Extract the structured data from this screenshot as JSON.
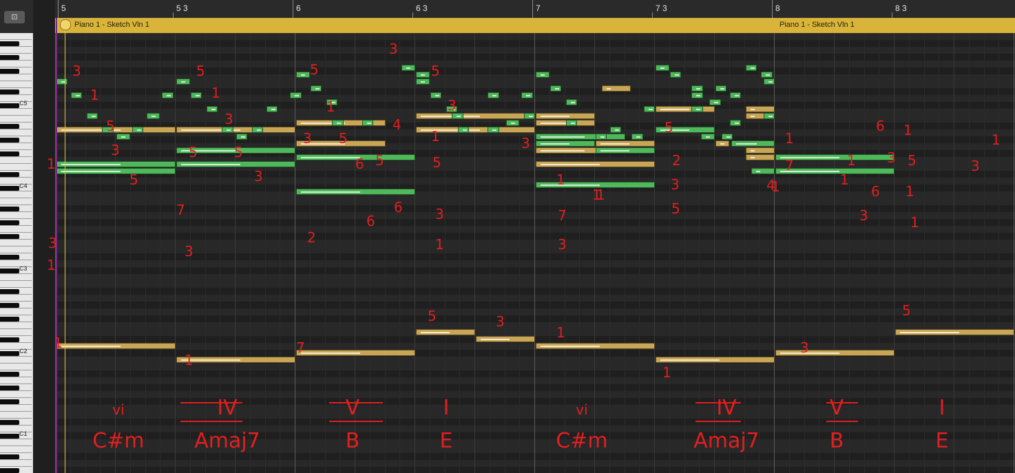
{
  "toolbar": {
    "catch_icon": "catch-playhead-icon",
    "catch_label": "⊡"
  },
  "ruler": {
    "bar_labels": [
      "5",
      "5 3",
      "6",
      "6 3",
      "7",
      "7 3",
      "8",
      "8 3"
    ]
  },
  "region": {
    "names": [
      "Piano 1 - Sketch Vln 1",
      "Piano 1 - Sketch Vln 1"
    ]
  },
  "keyboard": {
    "octave_labels": [
      "C5",
      "C4",
      "C3",
      "C2",
      "C1"
    ]
  },
  "colors": {
    "note_green": "#4fb85a",
    "note_gold": "#c9a655",
    "region": "#d8b43a",
    "annotation": "#e21f1f"
  },
  "notes": [
    {
      "row": 3,
      "start": 5.0,
      "len": 0.1,
      "c": "g"
    },
    {
      "row": 5,
      "start": 5.12,
      "len": 0.1,
      "c": "g"
    },
    {
      "row": 8,
      "start": 5.25,
      "len": 0.1,
      "c": "g"
    },
    {
      "row": 10,
      "start": 5.0,
      "len": 1.0,
      "c": "y"
    },
    {
      "row": 10,
      "start": 5.38,
      "len": 0.1,
      "c": "g"
    },
    {
      "row": 10,
      "start": 5.63,
      "len": 0.1,
      "c": "g"
    },
    {
      "row": 11,
      "start": 5.5,
      "len": 0.12,
      "c": "g"
    },
    {
      "row": 8,
      "start": 5.75,
      "len": 0.12,
      "c": "g"
    },
    {
      "row": 5,
      "start": 5.88,
      "len": 0.1,
      "c": "g"
    },
    {
      "row": 3,
      "start": 6.0,
      "len": 0.12,
      "c": "g"
    },
    {
      "row": 5,
      "start": 6.12,
      "len": 0.1,
      "c": "g"
    },
    {
      "row": 7,
      "start": 6.25,
      "len": 0.1,
      "c": "g"
    },
    {
      "row": 10,
      "start": 6.0,
      "len": 1.0,
      "c": "y"
    },
    {
      "row": 10,
      "start": 6.38,
      "len": 0.1,
      "c": "g"
    },
    {
      "row": 10,
      "start": 6.63,
      "len": 0.1,
      "c": "g"
    },
    {
      "row": 11,
      "start": 6.5,
      "len": 0.1,
      "c": "g"
    },
    {
      "row": 7,
      "start": 6.75,
      "len": 0.1,
      "c": "g"
    },
    {
      "row": 5,
      "start": 6.95,
      "len": 0.1,
      "c": "g"
    },
    {
      "row": 15,
      "start": 5.0,
      "len": 1.0,
      "c": "g"
    },
    {
      "row": 16,
      "start": 5.0,
      "len": 1.0,
      "c": "g"
    },
    {
      "row": 13,
      "start": 6.0,
      "len": 1.0,
      "c": "g"
    },
    {
      "row": 15,
      "start": 6.0,
      "len": 1.0,
      "c": "g"
    },
    {
      "row": 2,
      "start": 7.0,
      "len": 0.12,
      "c": "g"
    },
    {
      "row": 4,
      "start": 7.12,
      "len": 0.1,
      "c": "g"
    },
    {
      "row": 6,
      "start": 7.25,
      "len": 0.1,
      "c": "g"
    },
    {
      "row": 9,
      "start": 7.0,
      "len": 0.75,
      "c": "y"
    },
    {
      "row": 9,
      "start": 7.3,
      "len": 0.1,
      "c": "g"
    },
    {
      "row": 9,
      "start": 7.55,
      "len": 0.1,
      "c": "g"
    },
    {
      "row": 12,
      "start": 7.0,
      "len": 0.75,
      "c": "y"
    },
    {
      "row": 14,
      "start": 7.0,
      "len": 1.0,
      "c": "g"
    },
    {
      "row": 1,
      "start": 7.88,
      "len": 0.12,
      "c": "g"
    },
    {
      "row": 2,
      "start": 8.0,
      "len": 0.12,
      "c": "g"
    },
    {
      "row": 19,
      "start": 7.0,
      "len": 1.0,
      "c": "g"
    },
    {
      "row": 3,
      "start": 8.0,
      "len": 0.12,
      "c": "g"
    },
    {
      "row": 5,
      "start": 8.12,
      "len": 0.1,
      "c": "g"
    },
    {
      "row": 7,
      "start": 8.25,
      "len": 0.1,
      "c": "g"
    },
    {
      "row": 8,
      "start": 8.0,
      "len": 1.0,
      "c": "y"
    },
    {
      "row": 8,
      "start": 8.3,
      "len": 0.1,
      "c": "g"
    },
    {
      "row": 10,
      "start": 8.0,
      "len": 1.0,
      "c": "y"
    },
    {
      "row": 10,
      "start": 8.35,
      "len": 0.1,
      "c": "g"
    },
    {
      "row": 10,
      "start": 8.6,
      "len": 0.1,
      "c": "g"
    },
    {
      "row": 5,
      "start": 8.6,
      "len": 0.1,
      "c": "g"
    },
    {
      "row": 9,
      "start": 8.75,
      "len": 0.12,
      "c": "g"
    },
    {
      "row": 8,
      "start": 8.9,
      "len": 0.1,
      "c": "g"
    },
    {
      "row": 5,
      "start": 8.88,
      "len": 0.1,
      "c": "g"
    },
    {
      "row": 13,
      "start": 9.0,
      "len": 0.75,
      "c": "y"
    },
    {
      "row": 11,
      "start": 9.0,
      "len": 0.75,
      "c": "g"
    },
    {
      "row": 15,
      "start": 9.0,
      "len": 1.0,
      "c": "y"
    },
    {
      "row": 18,
      "start": 9.0,
      "len": 1.0,
      "c": "g"
    },
    {
      "row": 2,
      "start": 9.0,
      "len": 0.12,
      "c": "g"
    },
    {
      "row": 4,
      "start": 9.12,
      "len": 0.1,
      "c": "g"
    },
    {
      "row": 6,
      "start": 9.25,
      "len": 0.1,
      "c": "g"
    },
    {
      "row": 9,
      "start": 9.0,
      "len": 0.5,
      "c": "y"
    },
    {
      "row": 9,
      "start": 9.25,
      "len": 0.1,
      "c": "g"
    },
    {
      "row": 12,
      "start": 9.0,
      "len": 0.5,
      "c": "g"
    },
    {
      "row": 11,
      "start": 9.5,
      "len": 0.1,
      "c": "g"
    },
    {
      "row": 10,
      "start": 9.62,
      "len": 0.1,
      "c": "g"
    },
    {
      "row": 8,
      "start": 9.0,
      "len": 0.5,
      "c": "y"
    },
    {
      "row": 12,
      "start": 9.5,
      "len": 0.5,
      "c": "y"
    },
    {
      "row": 13,
      "start": 9.5,
      "len": 0.5,
      "c": "g"
    },
    {
      "row": 11,
      "start": 9.8,
      "len": 0.1,
      "c": "g"
    },
    {
      "row": 4,
      "start": 9.55,
      "len": 0.25,
      "c": "y"
    },
    {
      "row": 7,
      "start": 9.9,
      "len": 0.1,
      "c": "g"
    },
    {
      "row": 1,
      "start": 10.0,
      "len": 0.12,
      "c": "g"
    },
    {
      "row": 2,
      "start": 10.12,
      "len": 0.1,
      "c": "g"
    },
    {
      "row": 4,
      "start": 10.3,
      "len": 0.1,
      "c": "g"
    },
    {
      "row": 7,
      "start": 10.0,
      "len": 0.5,
      "c": "y"
    },
    {
      "row": 7,
      "start": 10.3,
      "len": 0.1,
      "c": "g"
    },
    {
      "row": 10,
      "start": 10.0,
      "len": 0.5,
      "c": "g"
    },
    {
      "row": 11,
      "start": 10.38,
      "len": 0.12,
      "c": "g"
    },
    {
      "row": 11,
      "start": 10.55,
      "len": 0.1,
      "c": "g"
    },
    {
      "row": 12,
      "start": 10.5,
      "len": 0.12,
      "c": "y"
    },
    {
      "row": 12,
      "start": 10.63,
      "len": 0.37,
      "c": "g"
    },
    {
      "row": 1,
      "start": 10.75,
      "len": 0.1,
      "c": "g"
    },
    {
      "row": 2,
      "start": 10.88,
      "len": 0.1,
      "c": "g"
    },
    {
      "row": 7,
      "start": 10.75,
      "len": 0.25,
      "c": "y"
    },
    {
      "row": 8,
      "start": 10.75,
      "len": 0.25,
      "c": "y"
    },
    {
      "row": 8,
      "start": 10.9,
      "len": 0.1,
      "c": "g"
    },
    {
      "row": 6,
      "start": 10.45,
      "len": 0.1,
      "c": "g"
    },
    {
      "row": 5,
      "start": 10.62,
      "len": 0.1,
      "c": "g"
    },
    {
      "row": 3,
      "start": 10.9,
      "len": 0.1,
      "c": "g"
    },
    {
      "row": 4,
      "start": 10.5,
      "len": 0.1,
      "c": "g"
    },
    {
      "row": 9,
      "start": 10.62,
      "len": 0.1,
      "c": "g"
    },
    {
      "row": 5,
      "start": 10.3,
      "len": 0.1,
      "c": "g"
    },
    {
      "row": 13,
      "start": 10.75,
      "len": 0.25,
      "c": "y"
    },
    {
      "row": 14,
      "start": 10.75,
      "len": 0.25,
      "c": "y"
    },
    {
      "row": 16,
      "start": 10.8,
      "len": 0.2,
      "c": "g"
    },
    {
      "row": 14,
      "start": 11.0,
      "len": 1.0,
      "c": "g"
    },
    {
      "row": 16,
      "start": 11.0,
      "len": 1.0,
      "c": "g"
    }
  ],
  "bass_notes": [
    {
      "lane": 45,
      "start": 5.0,
      "len": 1.0
    },
    {
      "lane": 47,
      "start": 6.0,
      "len": 1.0
    },
    {
      "lane": 46,
      "start": 7.0,
      "len": 1.0
    },
    {
      "lane": 43,
      "start": 8.0,
      "len": 0.5
    },
    {
      "lane": 44,
      "start": 8.5,
      "len": 0.5
    },
    {
      "lane": 45,
      "start": 9.0,
      "len": 1.0
    },
    {
      "lane": 47,
      "start": 10.0,
      "len": 1.0
    },
    {
      "lane": 46,
      "start": 11.0,
      "len": 1.0
    },
    {
      "lane": 43,
      "start": 12.0,
      "len": 1.0
    }
  ],
  "annotations": {
    "chords": [
      {
        "numeral": "vi",
        "name": "C#m"
      },
      {
        "numeral": "IV",
        "name": "Amaj7"
      },
      {
        "numeral": "V",
        "name": "B"
      },
      {
        "numeral": "I",
        "name": "E"
      },
      {
        "numeral": "vi",
        "name": "C#m"
      },
      {
        "numeral": "IV",
        "name": "Amaj7"
      },
      {
        "numeral": "V",
        "name": "B"
      },
      {
        "numeral": "I",
        "name": "E"
      }
    ],
    "fingerings": [
      "3",
      "1",
      "5",
      "3",
      "1",
      "5",
      "3",
      "1",
      "3",
      "5",
      "1",
      "3",
      "5",
      "5",
      "7",
      "3",
      "5",
      "1",
      "3",
      "5",
      "6",
      "5",
      "2",
      "6",
      "3",
      "5",
      "3",
      "4",
      "1",
      "5",
      "1",
      "6",
      "3",
      "3",
      "5",
      "3",
      "1",
      "1",
      "7",
      "3",
      "1",
      "5",
      "2",
      "3",
      "5",
      "4",
      "1",
      "7",
      "1",
      "6",
      "3",
      "5",
      "3",
      "6",
      "3",
      "1",
      "1",
      "5",
      "3",
      "1",
      "1",
      "7",
      "1",
      "1",
      "1",
      "1",
      "1",
      "1"
    ]
  }
}
